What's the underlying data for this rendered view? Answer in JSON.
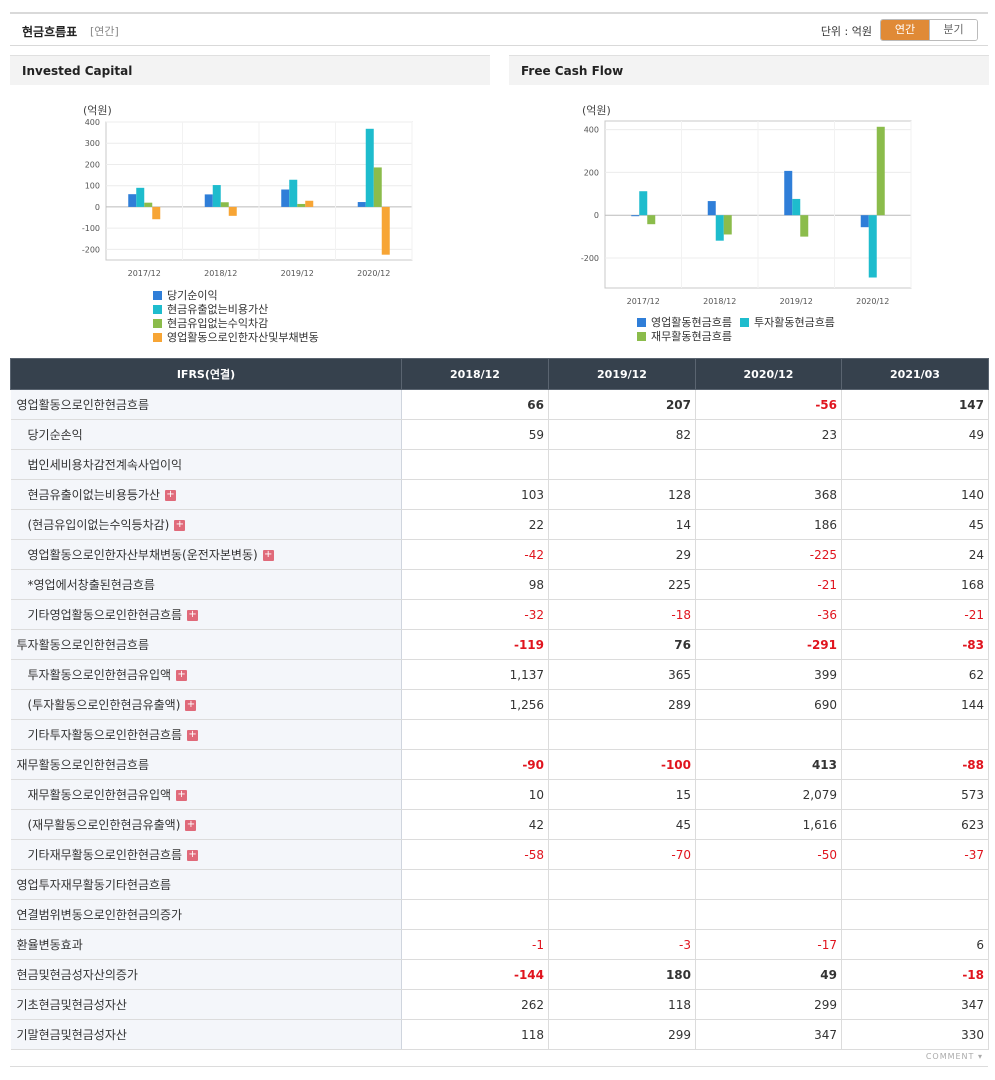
{
  "header": {
    "title": "현금흐름표",
    "period_tag": "[연간]",
    "unit": "단위 : 억원",
    "btn_annual": "연간",
    "btn_quarter": "분기"
  },
  "charts": {
    "invested": {
      "title": "Invested Capital",
      "unit_label": "(억원)"
    },
    "fcf": {
      "title": "Free Cash Flow",
      "unit_label": "(억원)"
    }
  },
  "chart_data": [
    {
      "type": "bar",
      "title": "Invested Capital",
      "ylabel": "(억원)",
      "categories": [
        "2017/12",
        "2018/12",
        "2019/12",
        "2020/12"
      ],
      "ylim": [
        -250,
        400
      ],
      "yticks": [
        400,
        300,
        200,
        100,
        0,
        -100,
        -200
      ],
      "grid": true,
      "legend": "bottom",
      "series": [
        {
          "name": "당기순이익",
          "color": "#2f7ed8",
          "values": [
            60,
            59,
            82,
            23
          ]
        },
        {
          "name": "현금유출없는비용가산",
          "color": "#1ebccd",
          "values": [
            90,
            103,
            128,
            368
          ]
        },
        {
          "name": "현금유입없는수익차감",
          "color": "#8bbc4b",
          "values": [
            20,
            22,
            14,
            186
          ]
        },
        {
          "name": "영업활동으로인한자산및부채변동",
          "color": "#f7a535",
          "values": [
            -58,
            -42,
            29,
            -225
          ]
        }
      ]
    },
    {
      "type": "bar",
      "title": "Free Cash Flow",
      "ylabel": "(억원)",
      "categories": [
        "2017/12",
        "2018/12",
        "2019/12",
        "2020/12"
      ],
      "ylim": [
        -340,
        440
      ],
      "yticks": [
        400,
        200,
        0,
        -200
      ],
      "grid": true,
      "legend": "bottom",
      "series": [
        {
          "name": "영업활동현금흐름",
          "color": "#2f7ed8",
          "values": [
            -3,
            66,
            207,
            -56
          ]
        },
        {
          "name": "투자활동현금흐름",
          "color": "#1ebccd",
          "values": [
            112,
            -119,
            76,
            -291
          ]
        },
        {
          "name": "재무활동현금흐름",
          "color": "#8bbc4b",
          "values": [
            -42,
            -90,
            -100,
            413
          ]
        }
      ]
    }
  ],
  "table": {
    "corner": "IFRS(연결)",
    "columns": [
      "2018/12",
      "2019/12",
      "2020/12",
      "2021/03"
    ],
    "rows": [
      {
        "label": "영업활동으로인한현금흐름",
        "bold": true,
        "sub": false,
        "plus": false,
        "values": [
          "66",
          "207",
          "-56",
          "147"
        ]
      },
      {
        "label": "당기순손익",
        "bold": false,
        "sub": true,
        "plus": false,
        "values": [
          "59",
          "82",
          "23",
          "49"
        ]
      },
      {
        "label": "법인세비용차감전계속사업이익",
        "bold": false,
        "sub": true,
        "plus": false,
        "values": [
          "",
          "",
          "",
          ""
        ]
      },
      {
        "label": "현금유출이없는비용등가산",
        "bold": false,
        "sub": true,
        "plus": true,
        "values": [
          "103",
          "128",
          "368",
          "140"
        ]
      },
      {
        "label": "(현금유입이없는수익등차감)",
        "bold": false,
        "sub": true,
        "plus": true,
        "values": [
          "22",
          "14",
          "186",
          "45"
        ]
      },
      {
        "label": "영업활동으로인한자산부채변동(운전자본변동)",
        "bold": false,
        "sub": true,
        "plus": true,
        "values": [
          "-42",
          "29",
          "-225",
          "24"
        ]
      },
      {
        "label": "*영업에서창출된현금흐름",
        "bold": false,
        "sub": true,
        "plus": false,
        "values": [
          "98",
          "225",
          "-21",
          "168"
        ]
      },
      {
        "label": "기타영업활동으로인한현금흐름",
        "bold": false,
        "sub": true,
        "plus": true,
        "values": [
          "-32",
          "-18",
          "-36",
          "-21"
        ]
      },
      {
        "label": "투자활동으로인한현금흐름",
        "bold": true,
        "sub": false,
        "plus": false,
        "values": [
          "-119",
          "76",
          "-291",
          "-83"
        ]
      },
      {
        "label": "투자활동으로인한현금유입액",
        "bold": false,
        "sub": true,
        "plus": true,
        "values": [
          "1,137",
          "365",
          "399",
          "62"
        ]
      },
      {
        "label": "(투자활동으로인한현금유출액)",
        "bold": false,
        "sub": true,
        "plus": true,
        "values": [
          "1,256",
          "289",
          "690",
          "144"
        ]
      },
      {
        "label": "기타투자활동으로인한현금흐름",
        "bold": false,
        "sub": true,
        "plus": true,
        "values": [
          "",
          "",
          "",
          ""
        ]
      },
      {
        "label": "재무활동으로인한현금흐름",
        "bold": true,
        "sub": false,
        "plus": false,
        "values": [
          "-90",
          "-100",
          "413",
          "-88"
        ]
      },
      {
        "label": "재무활동으로인한현금유입액",
        "bold": false,
        "sub": true,
        "plus": true,
        "values": [
          "10",
          "15",
          "2,079",
          "573"
        ]
      },
      {
        "label": "(재무활동으로인한현금유출액)",
        "bold": false,
        "sub": true,
        "plus": true,
        "values": [
          "42",
          "45",
          "1,616",
          "623"
        ]
      },
      {
        "label": "기타재무활동으로인한현금흐름",
        "bold": false,
        "sub": true,
        "plus": true,
        "values": [
          "-58",
          "-70",
          "-50",
          "-37"
        ]
      },
      {
        "label": "영업투자재무활동기타현금흐름",
        "bold": false,
        "sub": false,
        "plus": false,
        "values": [
          "",
          "",
          "",
          ""
        ]
      },
      {
        "label": "연결범위변동으로인한현금의증가",
        "bold": false,
        "sub": false,
        "plus": false,
        "values": [
          "",
          "",
          "",
          ""
        ]
      },
      {
        "label": "환율변동효과",
        "bold": false,
        "sub": false,
        "plus": false,
        "values": [
          "-1",
          "-3",
          "-17",
          "6"
        ]
      },
      {
        "label": "현금및현금성자산의증가",
        "bold": true,
        "sub": false,
        "plus": false,
        "values": [
          "-144",
          "180",
          "49",
          "-18"
        ]
      },
      {
        "label": "기초현금및현금성자산",
        "bold": false,
        "sub": false,
        "plus": false,
        "values": [
          "262",
          "118",
          "299",
          "347"
        ]
      },
      {
        "label": "기말현금및현금성자산",
        "bold": false,
        "sub": false,
        "plus": false,
        "values": [
          "118",
          "299",
          "347",
          "330"
        ]
      }
    ]
  },
  "footer": {
    "comment": "COMMENT"
  }
}
